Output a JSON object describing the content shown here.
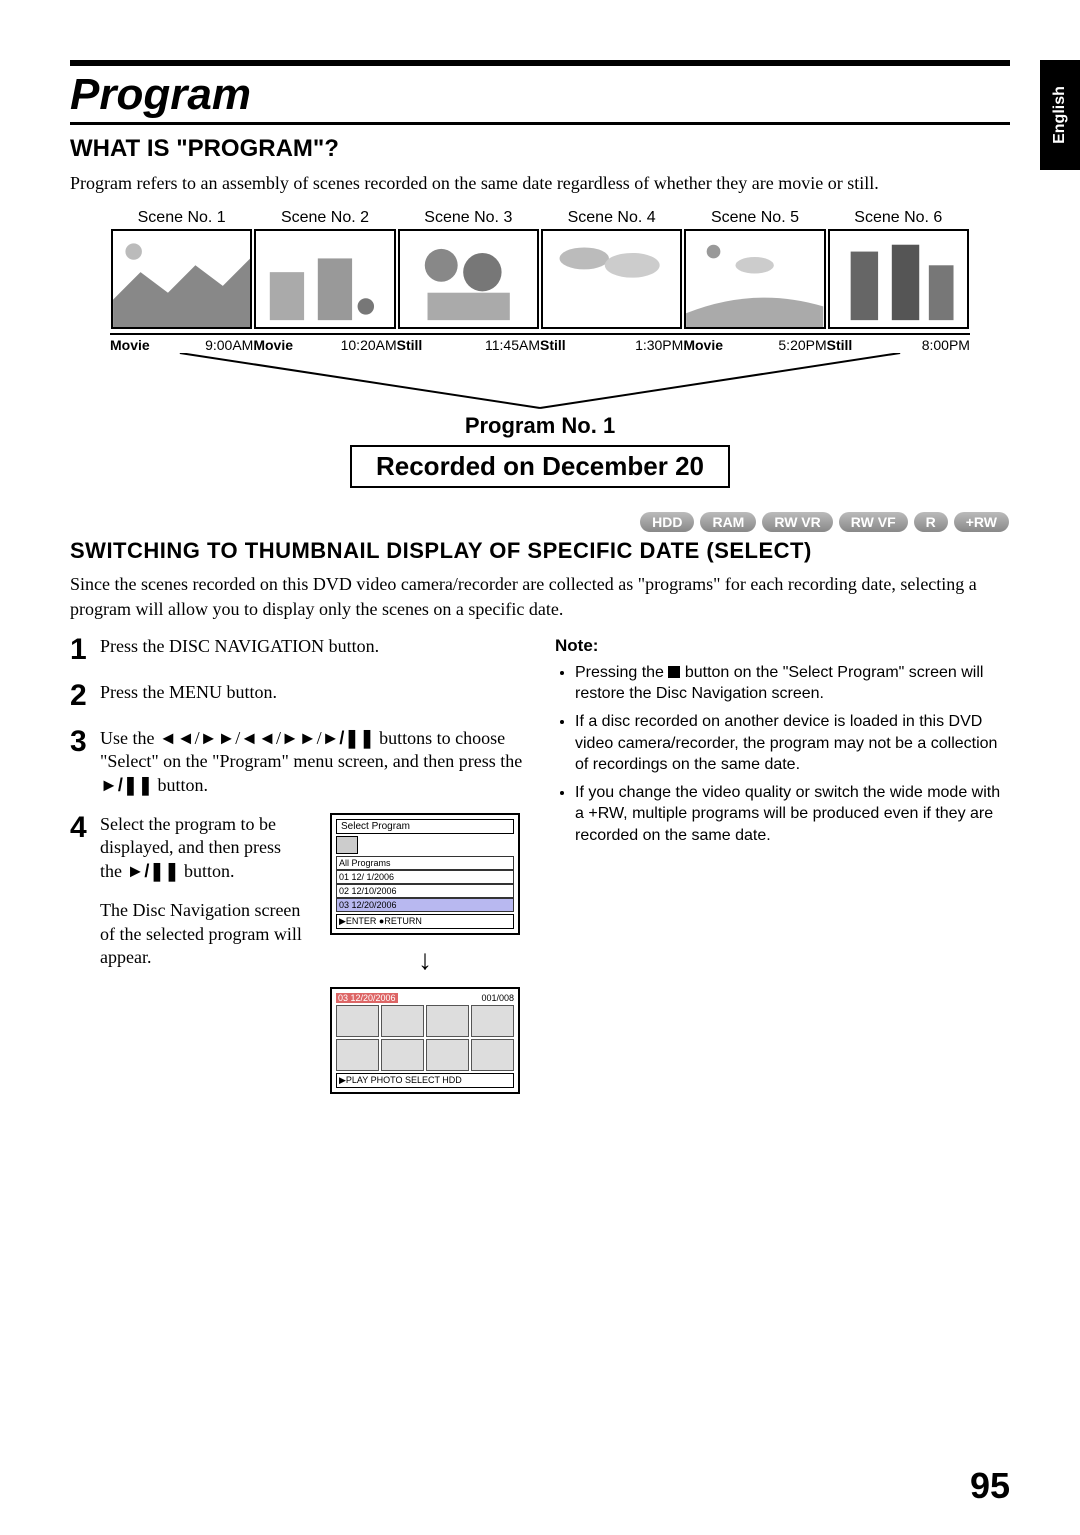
{
  "lang_tab": "English",
  "chapter_title": "Program",
  "section1": {
    "heading": "WHAT IS \"PROGRAM\"?",
    "body": "Program refers to an assembly of scenes recorded on the same date regardless of whether they are movie or still."
  },
  "diagram": {
    "scene_labels": [
      "Scene No. 1",
      "Scene No. 2",
      "Scene No. 3",
      "Scene No. 4",
      "Scene No. 5",
      "Scene No. 6"
    ],
    "timeline": [
      {
        "type": "Movie",
        "time": "9:00AM"
      },
      {
        "type": "Movie",
        "time": "10:20AM"
      },
      {
        "type": "Still",
        "time": "11:45AM"
      },
      {
        "type": "Still",
        "time": "1:30PM"
      },
      {
        "type": "Movie",
        "time": "5:20PM"
      },
      {
        "type": "Still",
        "time": "8:00PM"
      }
    ],
    "program_no": "Program No. 1",
    "recorded_on": "Recorded on December 20"
  },
  "disc_badges": [
    "HDD",
    "RAM",
    "RW VR",
    "RW VF",
    "R",
    "+RW"
  ],
  "section2": {
    "heading": "SWITCHING TO THUMBNAIL DISPLAY OF SPECIFIC DATE (SELECT)",
    "body": "Since the scenes recorded on this DVD video camera/recorder are collected as \"programs\" for each recording date, selecting a program will allow you to display only the scenes on a specific date.",
    "steps": [
      "Press the DISC NAVIGATION button.",
      "Press the MENU button.",
      "Use the ⏮/⏭/⏪/⏩/▶/⏸ buttons to choose \"Select\" on the \"Program\" menu screen, and then press the ▶/⏸ button.",
      "Select the program to be displayed, and then press the ▶/⏸ button."
    ],
    "step4_extra": "The Disc Navigation screen of the selected program will appear.",
    "screenshot1": {
      "title": "Select Program",
      "rows": [
        "All Programs",
        "01  12/  1/2006",
        "02  12/10/2006",
        "03  12/20/2006"
      ],
      "footer": "▶ENTER  ●RETURN"
    },
    "screenshot2": {
      "header_left": "03  12/20/2006",
      "header_right": "001/008",
      "footer": "▶PLAY PHOTO SELECT          HDD"
    },
    "note_heading": "Note:",
    "notes": [
      "Pressing the ■ button on the \"Select Program\" screen will restore the Disc Navigation screen.",
      "If a disc recorded on another device is loaded in this DVD video camera/recorder, the program may not be a collection of recordings on the same date.",
      "If you change the video quality or switch the wide mode with a +RW, multiple programs will be produced even if they are recorded on the same date."
    ]
  },
  "page_number": "95"
}
